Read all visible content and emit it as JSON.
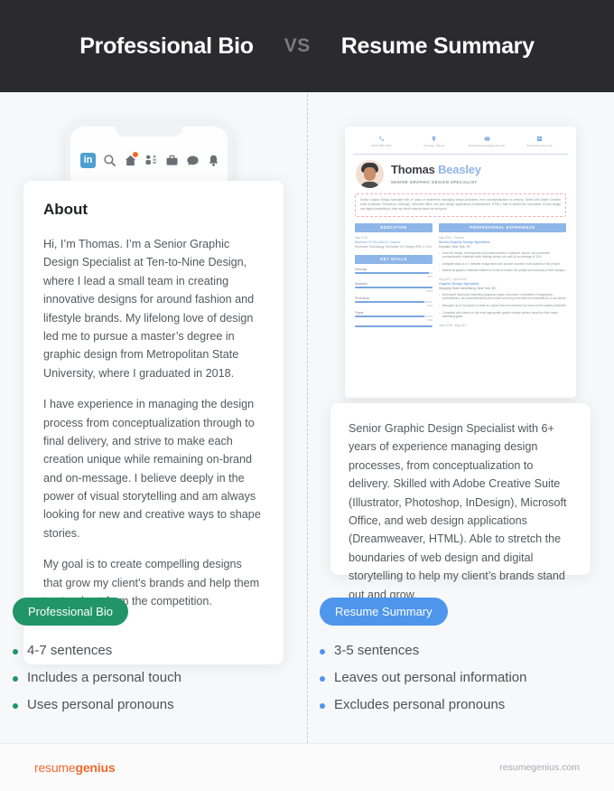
{
  "header": {
    "left_title": "Professional Bio",
    "vs": "VS",
    "right_title": "Resume Summary"
  },
  "left": {
    "phone": {
      "brand": "in",
      "icons": [
        "search-icon",
        "home-icon",
        "network-icon",
        "jobs-icon",
        "messaging-icon",
        "notifications-icon"
      ]
    },
    "card": {
      "title": "About",
      "paragraphs": [
        "Hi, I’m Thomas. I’m a Senior Graphic Design Specialist at Ten-to-Nine Design, where I lead a small team in creating innovative designs for around fashion and lifestyle brands. My lifelong love of design led me to pursue a master’s degree in graphic design from Metropolitan State University, where I graduated in 2018.",
        "I have experience in managing the design process from conceptualization through to final delivery, and strive to make each creation unique while remaining on-brand and on-message. I believe deeply in the power of visual storytelling and am always looking for new and creative ways to shape stories.",
        "My goal is to create compelling designs that grow my client’s brands and help them to stand out from the competition."
      ]
    },
    "badge": {
      "label": "Professional Bio",
      "color": "#219567"
    },
    "bullets": [
      "4-7 sentences",
      "Includes a personal touch",
      "Uses personal pronouns"
    ]
  },
  "right": {
    "resume": {
      "contacts": [
        {
          "icon": "phone-icon",
          "text": "(212) 256-1414"
        },
        {
          "icon": "location-icon",
          "text": "Chicago, Illinois"
        },
        {
          "icon": "email-icon",
          "text": "thomasbeasley@gmail.com"
        },
        {
          "icon": "website-icon",
          "text": "thomasbeasley.com"
        }
      ],
      "first_name": "Thomas",
      "last_name": "Beasley",
      "role": "SENIOR GRAPHIC DESIGN SPECIALIST",
      "summary": "Senior Graphic Design Specialist with 6+ years of experience managing design processes, from conceptualization to delivery. Skilled with Adobe Creative Suite (Illustrator, Photoshop, InDesign), Microsoft Office, and web design applications (Dreamweaver, HTML). Able to stretch the boundaries of web design and digital storytelling to help my client’s brands stand out and grow.",
      "education_header": "EDUCATION",
      "education": {
        "date": "May 2015",
        "degree": "Bachelor Of Fine Arts In Graphic",
        "details": "Rochester Technology, Rochester NY Design GPA: 3.7/4.0"
      },
      "skills_header": "KEY SKILLS",
      "skills": [
        {
          "name": "InDesign",
          "pct": "95%",
          "value": 95
        },
        {
          "name": "Illustrator",
          "pct": "100%",
          "value": 100
        },
        {
          "name": "Photoshop",
          "pct": "90%",
          "value": 90
        },
        {
          "name": "Figma",
          "pct": "90%",
          "value": 90
        }
      ],
      "experience_header": "PROFESSIONAL EXPERIENCE",
      "jobs": [
        {
          "date": "May 2019 - Present",
          "title": "Senior Graphic Design Specialist",
          "org": "Expolsis, New York, NY",
          "bullets": [
            "Lead the design, development and implementation of graphic, layout, and production communication materials while helping clients cut costs by an average of 12%",
            "Delegate tasks to a 7-member design team and provide counsel on all aspects of the project",
            "Assess all graphic materials created in-house to ensure the quality and accuracy of their designs"
          ]
        },
        {
          "date": "Aug 2017 - April 2019",
          "title": "Graphic Design Specialist",
          "org": "Stepping Stone Advertising, New York, NY",
          "bullets": [
            "Developed numerous marketing programs (logos, brochures, newsletters, infographics, presentations, and advertisements) and made sure they exceeded the expectations of our clients",
            "Managed up to 5 projects or tasks at a given time and ensured our team met its weekly deadlines",
            "Consulted with clients on the most appropriate graphic design options based on their major marketing goals"
          ]
        },
        {
          "date": "June 2015 - May 2017",
          "title": "",
          "org": "",
          "bullets": []
        }
      ]
    },
    "card": {
      "paragraph": "Senior Graphic Design Specialist with 6+ years of experience managing design processes, from conceptualization to delivery. Skilled with Adobe Creative Suite (Illustrator, Photoshop, InDesign), Microsoft Office, and web design applications (Dreamweaver, HTML). Able to stretch the boundaries of web design and digital storytelling to help my client’s brands stand out and grow."
    },
    "badge": {
      "label": "Resume Summary",
      "color": "#4e95ec"
    },
    "bullets": [
      "3-5 sentences",
      "Leaves out personal information",
      "Excludes personal pronouns"
    ]
  },
  "footer": {
    "logo_light": "resume",
    "logo_bold": "genius",
    "url": "resumegenius.com"
  }
}
